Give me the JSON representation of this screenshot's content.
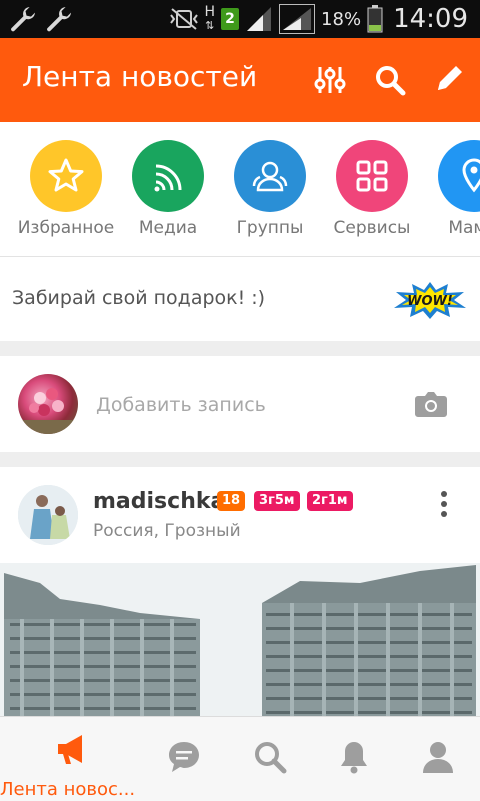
{
  "status_bar": {
    "network_letter": "H",
    "sim_slot": "2",
    "battery_percent": "18%",
    "time": "14:09"
  },
  "header": {
    "title": "Лента новостей",
    "icons": [
      "filter-sliders-icon",
      "search-icon",
      "edit-pencil-icon"
    ]
  },
  "categories": [
    {
      "label": "Избранное",
      "icon": "star-icon",
      "color": "#ffc629"
    },
    {
      "label": "Медиа",
      "icon": "media-feed-icon",
      "color": "#19a55e"
    },
    {
      "label": "Группы",
      "icon": "groups-icon",
      "color": "#2a8fd6"
    },
    {
      "label": "Сервисы",
      "icon": "services-grid-icon",
      "color": "#f0457a"
    },
    {
      "label": "Мамы",
      "icon": "location-pin-icon",
      "color": "#2196f3"
    }
  ],
  "gift": {
    "text": "Забирай свой подарок! :)",
    "sticker_text": "WOW!"
  },
  "add_post": {
    "placeholder": "Добавить запись",
    "icon": "camera-icon"
  },
  "post": {
    "author": "madischka",
    "badges": [
      "18",
      "3г5м",
      "2г1м"
    ],
    "badge_colors": [
      "#ff6d00",
      "#ec1a63",
      "#ec1a63"
    ],
    "location": "Россия, Грозный"
  },
  "bottom_nav": {
    "active_label": "Лента новос...",
    "items": [
      "megaphone-icon",
      "messages-icon",
      "search-icon",
      "notifications-bell-icon",
      "profile-icon"
    ]
  },
  "colors": {
    "accent": "#ff5a0d",
    "status_bar": "#0d0d0d",
    "icon_gray": "#9e9e9e"
  }
}
